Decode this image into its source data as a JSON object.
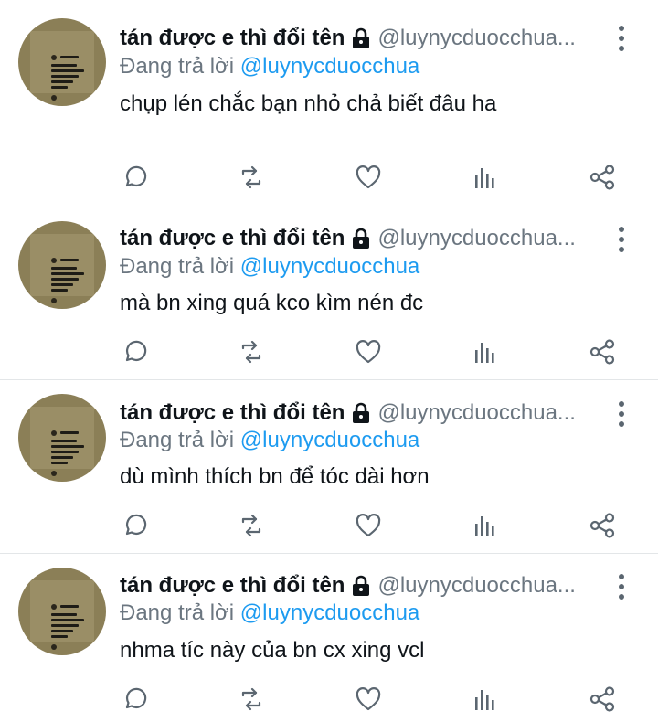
{
  "colors": {
    "name": "#0f1419",
    "secondary": "#6b7680",
    "mention": "#1d9bf0",
    "icon": "#5b6670",
    "divider": "#e3e6e8",
    "avatar_bg": "#8b7f57"
  },
  "icons": {
    "lock": "lock-icon",
    "reply": "reply-icon",
    "retweet": "retweet-icon",
    "like": "heart-icon",
    "views": "views-icon",
    "share": "share-icon",
    "more": "more-vertical-icon"
  },
  "tweets": [
    {
      "display_name": "tán được e thì đổi tên",
      "handle": "@luynycduocchua...",
      "reply_prefix": "Đang trả lời",
      "reply_to": "@luynycduocchua",
      "text": "chụp lén chắc bạn nhỏ chả biết đâu ha"
    },
    {
      "display_name": "tán được e thì đổi tên",
      "handle": "@luynycduocchua...",
      "reply_prefix": "Đang trả lời",
      "reply_to": "@luynycduocchua",
      "text": "mà bn xing quá kco kìm nén đc"
    },
    {
      "display_name": "tán được e thì đổi tên",
      "handle": "@luynycduocchua...",
      "reply_prefix": "Đang trả lời",
      "reply_to": "@luynycduocchua",
      "text": "dù mình thích bn để tóc dài hơn"
    },
    {
      "display_name": "tán được e thì đổi tên",
      "handle": "@luynycduocchua...",
      "reply_prefix": "Đang trả lời",
      "reply_to": "@luynycduocchua",
      "text": "nhma tíc này của bn cx xing vcl"
    }
  ]
}
